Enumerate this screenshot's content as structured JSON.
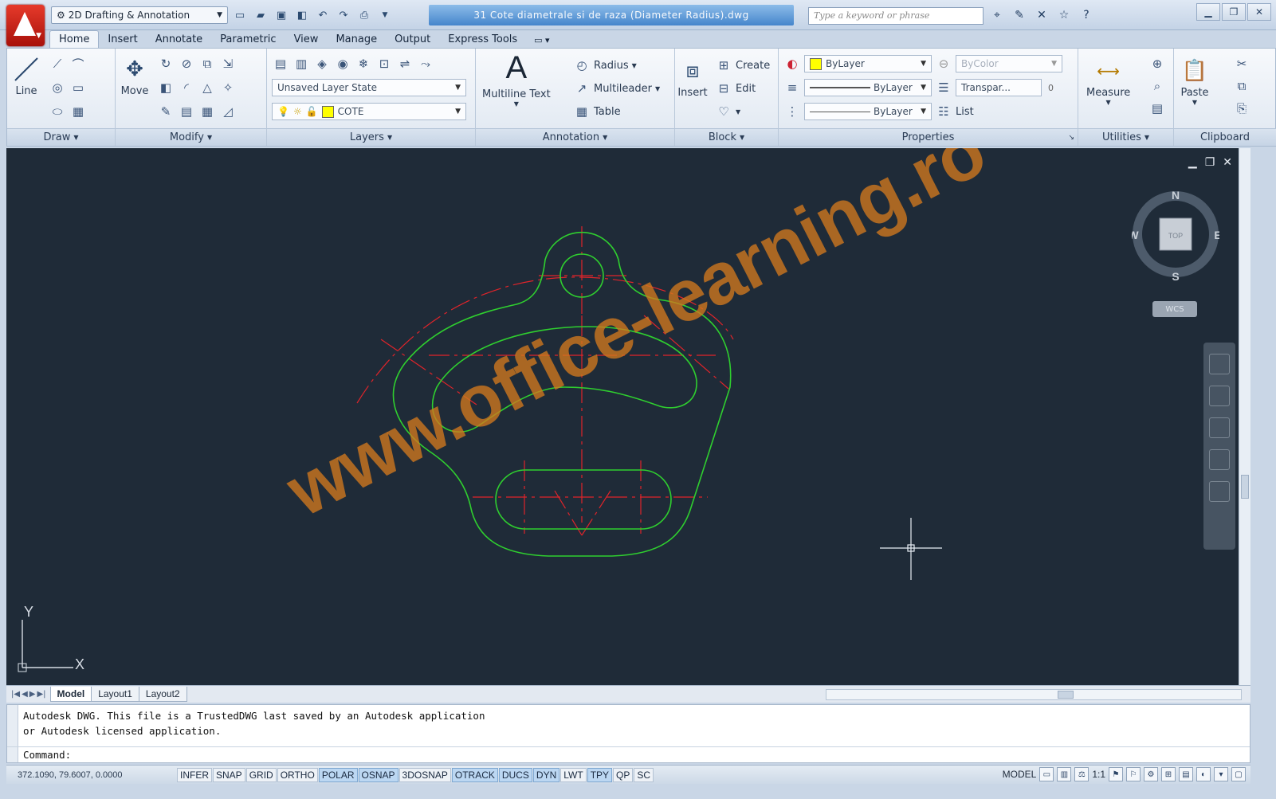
{
  "qat": {
    "workspace": "2D Drafting & Annotation",
    "document_title": "31 Cote diametrale si de raza (Diameter Radius).dwg",
    "search_placeholder": "Type a keyword or phrase"
  },
  "ribbon_tabs": [
    "Home",
    "Insert",
    "Annotate",
    "Parametric",
    "View",
    "Manage",
    "Output",
    "Express Tools"
  ],
  "active_tab": "Home",
  "panels": {
    "draw": {
      "title": "Draw",
      "line_label": "Line"
    },
    "modify": {
      "title": "Modify",
      "move_label": "Move"
    },
    "layers": {
      "title": "Layers",
      "layer_state": "Unsaved Layer State",
      "current_layer": "COTE"
    },
    "annotation": {
      "title": "Annotation",
      "multiline_text": "Multiline Text",
      "radius": "Radius",
      "multileader": "Multileader",
      "table": "Table"
    },
    "block": {
      "title": "Block",
      "insert": "Insert",
      "create": "Create",
      "edit": "Edit"
    },
    "properties": {
      "title": "Properties",
      "color": "ByLayer",
      "color_style": "ByColor",
      "linetype": "ByLayer",
      "lineweight": "ByLayer",
      "transparency": "Transpar...",
      "transparency_value": "0",
      "list": "List"
    },
    "utilities": {
      "title": "Utilities",
      "measure": "Measure"
    },
    "clipboard": {
      "title": "Clipboard",
      "paste": "Paste"
    }
  },
  "viewport": {
    "watermark": "www.office-learning.ro",
    "compass": {
      "n": "N",
      "s": "S",
      "e": "E",
      "w": "W",
      "top": "TOP",
      "wcs": "WCS"
    },
    "ucs": {
      "x": "X",
      "y": "Y"
    }
  },
  "layout_tabs": [
    "Model",
    "Layout1",
    "Layout2"
  ],
  "command": {
    "line1": "Autodesk DWG.  This file is a TrustedDWG last saved by an Autodesk application",
    "line2": "or Autodesk licensed application.",
    "prompt": "Command:"
  },
  "status": {
    "coordinates": "372.1090, 79.6007, 0.0000",
    "toggles": [
      {
        "label": "INFER",
        "on": false
      },
      {
        "label": "SNAP",
        "on": false
      },
      {
        "label": "GRID",
        "on": false
      },
      {
        "label": "ORTHO",
        "on": false
      },
      {
        "label": "POLAR",
        "on": true
      },
      {
        "label": "OSNAP",
        "on": true
      },
      {
        "label": "3DOSNAP",
        "on": false
      },
      {
        "label": "OTRACK",
        "on": true
      },
      {
        "label": "DUCS",
        "on": true
      },
      {
        "label": "DYN",
        "on": true
      },
      {
        "label": "LWT",
        "on": false
      },
      {
        "label": "TPY",
        "on": true
      },
      {
        "label": "QP",
        "on": false
      },
      {
        "label": "SC",
        "on": false
      }
    ],
    "model": "MODEL",
    "scale": "1:1"
  },
  "colors": {
    "canvas": "#1f2b38",
    "geometry": "#2fcf2f",
    "center_lines": "#e0242a",
    "watermark": "#d2781e"
  }
}
